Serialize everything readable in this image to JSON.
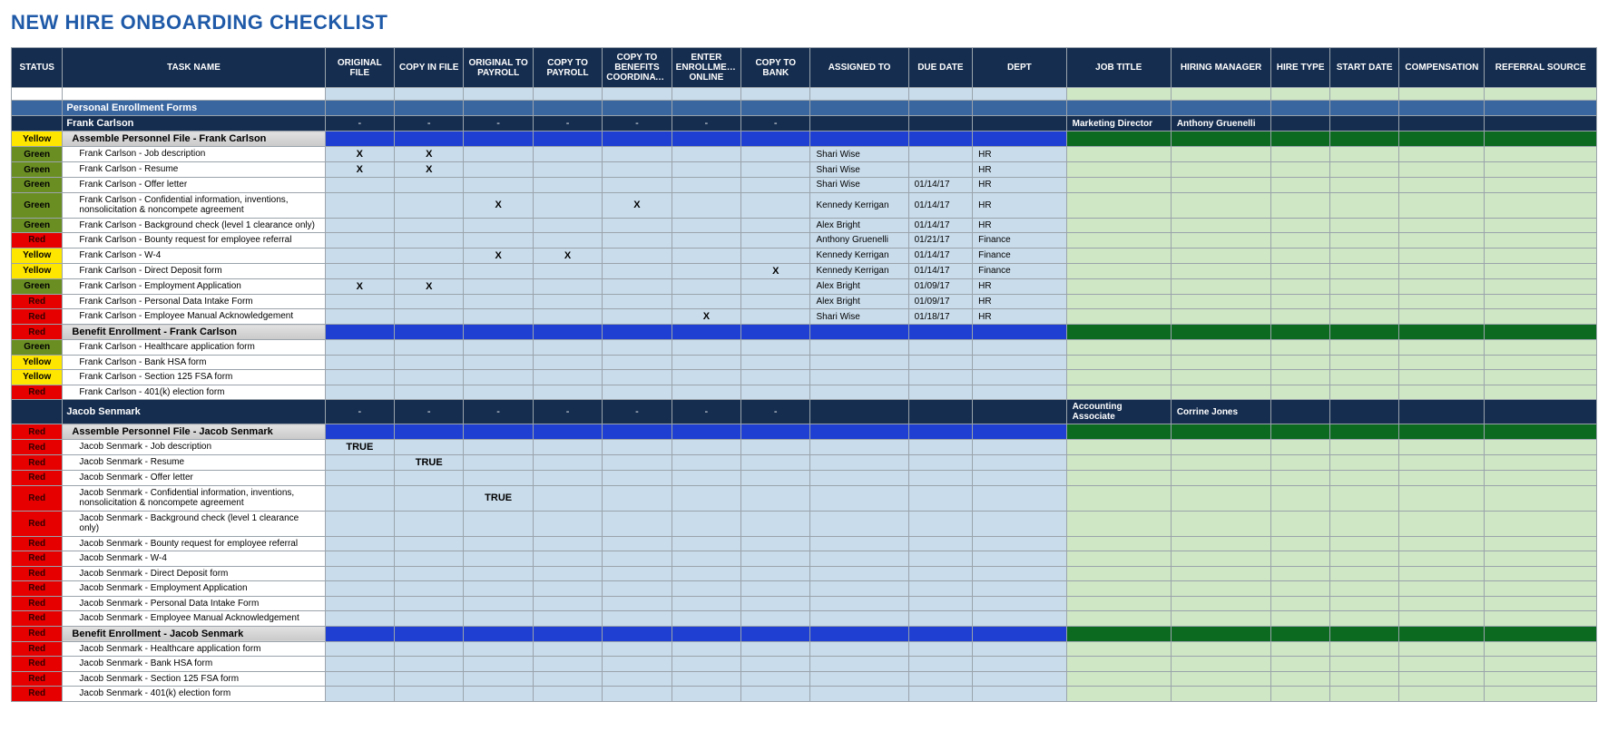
{
  "title": "NEW HIRE ONBOARDING CHECKLIST",
  "headers": {
    "status": "STATUS",
    "task": "TASK NAME",
    "orig": "ORIGINAL FILE",
    "copy": "COPY IN FILE",
    "payroll": "ORIGINAL TO PAYROLL",
    "copypay": "COPY TO PAYROLL",
    "benefits": "COPY TO BENEFITS COORDINATOR",
    "enroll": "ENTER ENROLLMENT ONLINE",
    "bank": "COPY TO BANK",
    "assigned": "ASSIGNED TO",
    "due": "DUE DATE",
    "dept": "DEPT",
    "job": "JOB TITLE",
    "hm": "HIRING MANAGER",
    "htype": "HIRE TYPE",
    "sdate": "START DATE",
    "comp": "COMPENSATION",
    "ref": "REFERRAL SOURCE"
  },
  "section_major": "Personal Enrollment Forms",
  "fc": {
    "name": "Frank Carlson",
    "job": "Marketing Director",
    "hm": "Anthony Gruenelli",
    "group1": "Assemble Personnel File - Frank Carlson",
    "group1_status": "Yellow",
    "tasks1": [
      {
        "s": "Green",
        "n": "Frank Carlson - Job description",
        "x": [
          "X",
          "X",
          "",
          "",
          "",
          "",
          ""
        ],
        "a": "Shari Wise",
        "d": "",
        "p": "HR"
      },
      {
        "s": "Green",
        "n": "Frank Carlson - Resume",
        "x": [
          "X",
          "X",
          "",
          "",
          "",
          "",
          ""
        ],
        "a": "Shari Wise",
        "d": "",
        "p": "HR"
      },
      {
        "s": "Green",
        "n": "Frank Carlson - Offer letter",
        "x": [
          "",
          "",
          "",
          "",
          "",
          "",
          ""
        ],
        "a": "Shari Wise",
        "d": "01/14/17",
        "p": "HR"
      },
      {
        "s": "Green",
        "n": "Frank Carlson - Confidential information, inventions, nonsolicitation & noncompete agreement",
        "x": [
          "",
          "",
          "X",
          "",
          "X",
          "",
          ""
        ],
        "a": "Kennedy Kerrigan",
        "d": "01/14/17",
        "p": "HR"
      },
      {
        "s": "Green",
        "n": "Frank Carlson - Background check (level 1 clearance only)",
        "x": [
          "",
          "",
          "",
          "",
          "",
          "",
          ""
        ],
        "a": "Alex Bright",
        "d": "01/14/17",
        "p": "HR"
      },
      {
        "s": "Red",
        "n": "Frank Carlson - Bounty request for employee referral",
        "x": [
          "",
          "",
          "",
          "",
          "",
          "",
          ""
        ],
        "a": "Anthony Gruenelli",
        "d": "01/21/17",
        "p": "Finance"
      },
      {
        "s": "Yellow",
        "n": "Frank Carlson - W-4",
        "x": [
          "",
          "",
          "X",
          "X",
          "",
          "",
          ""
        ],
        "a": "Kennedy Kerrigan",
        "d": "01/14/17",
        "p": "Finance"
      },
      {
        "s": "Yellow",
        "n": "Frank Carlson - Direct Deposit form",
        "x": [
          "",
          "",
          "",
          "",
          "",
          "",
          "X"
        ],
        "a": "Kennedy Kerrigan",
        "d": "01/14/17",
        "p": "Finance"
      },
      {
        "s": "Green",
        "n": "Frank Carlson - Employment Application",
        "x": [
          "X",
          "X",
          "",
          "",
          "",
          "",
          ""
        ],
        "a": "Alex Bright",
        "d": "01/09/17",
        "p": "HR"
      },
      {
        "s": "Red",
        "n": "Frank Carlson - Personal Data Intake Form",
        "x": [
          "",
          "",
          "",
          "",
          "",
          "",
          ""
        ],
        "a": "Alex Bright",
        "d": "01/09/17",
        "p": "HR"
      },
      {
        "s": "Red",
        "n": "Frank Carlson - Employee Manual Acknowledgement",
        "x": [
          "",
          "",
          "",
          "",
          "",
          "X",
          ""
        ],
        "a": "Shari Wise",
        "d": "01/18/17",
        "p": "HR"
      }
    ],
    "group2": "Benefit Enrollment - Frank Carlson",
    "group2_status": "Red",
    "tasks2": [
      {
        "s": "Green",
        "n": "Frank Carlson - Healthcare application form",
        "x": [
          "",
          "",
          "",
          "",
          "",
          "",
          ""
        ],
        "a": "",
        "d": "",
        "p": ""
      },
      {
        "s": "Yellow",
        "n": "Frank Carlson - Bank HSA form",
        "x": [
          "",
          "",
          "",
          "",
          "",
          "",
          ""
        ],
        "a": "",
        "d": "",
        "p": ""
      },
      {
        "s": "Yellow",
        "n": "Frank Carlson - Section 125 FSA form",
        "x": [
          "",
          "",
          "",
          "",
          "",
          "",
          ""
        ],
        "a": "",
        "d": "",
        "p": ""
      },
      {
        "s": "Red",
        "n": "Frank Carlson - 401(k) election form",
        "x": [
          "",
          "",
          "",
          "",
          "",
          "",
          ""
        ],
        "a": "",
        "d": "",
        "p": ""
      }
    ]
  },
  "js": {
    "name": "Jacob Senmark",
    "job": "Accounting Associate",
    "hm": "Corrine Jones",
    "group1": "Assemble Personnel File - Jacob Senmark",
    "group1_status": "Red",
    "tasks1": [
      {
        "s": "Red",
        "n": "Jacob Senmark - Job description",
        "x": [
          "TRUE",
          "",
          "",
          "",
          "",
          "",
          ""
        ],
        "a": "",
        "d": "",
        "p": ""
      },
      {
        "s": "Red",
        "n": "Jacob Senmark - Resume",
        "x": [
          "",
          "TRUE",
          "",
          "",
          "",
          "",
          ""
        ],
        "a": "",
        "d": "",
        "p": ""
      },
      {
        "s": "Red",
        "n": "Jacob Senmark - Offer letter",
        "x": [
          "",
          "",
          "",
          "",
          "",
          "",
          ""
        ],
        "a": "",
        "d": "",
        "p": ""
      },
      {
        "s": "Red",
        "n": "Jacob Senmark - Confidential information, inventions, nonsolicitation & noncompete agreement",
        "x": [
          "",
          "",
          "TRUE",
          "",
          "",
          "",
          ""
        ],
        "a": "",
        "d": "",
        "p": ""
      },
      {
        "s": "Red",
        "n": "Jacob Senmark - Background check (level 1 clearance only)",
        "x": [
          "",
          "",
          "",
          "",
          "",
          "",
          ""
        ],
        "a": "",
        "d": "",
        "p": ""
      },
      {
        "s": "Red",
        "n": "Jacob Senmark - Bounty request for employee referral",
        "x": [
          "",
          "",
          "",
          "",
          "",
          "",
          ""
        ],
        "a": "",
        "d": "",
        "p": ""
      },
      {
        "s": "Red",
        "n": "Jacob Senmark - W-4",
        "x": [
          "",
          "",
          "",
          "",
          "",
          "",
          ""
        ],
        "a": "",
        "d": "",
        "p": ""
      },
      {
        "s": "Red",
        "n": "Jacob Senmark - Direct Deposit form",
        "x": [
          "",
          "",
          "",
          "",
          "",
          "",
          ""
        ],
        "a": "",
        "d": "",
        "p": ""
      },
      {
        "s": "Red",
        "n": "Jacob Senmark - Employment Application",
        "x": [
          "",
          "",
          "",
          "",
          "",
          "",
          ""
        ],
        "a": "",
        "d": "",
        "p": ""
      },
      {
        "s": "Red",
        "n": "Jacob Senmark - Personal Data Intake Form",
        "x": [
          "",
          "",
          "",
          "",
          "",
          "",
          ""
        ],
        "a": "",
        "d": "",
        "p": ""
      },
      {
        "s": "Red",
        "n": "Jacob Senmark - Employee Manual Acknowledgement",
        "x": [
          "",
          "",
          "",
          "",
          "",
          "",
          ""
        ],
        "a": "",
        "d": "",
        "p": ""
      }
    ],
    "group2": "Benefit Enrollment - Jacob Senmark",
    "group2_status": "Red",
    "tasks2": [
      {
        "s": "Red",
        "n": "Jacob Senmark - Healthcare application form",
        "x": [
          "",
          "",
          "",
          "",
          "",
          "",
          ""
        ],
        "a": "",
        "d": "",
        "p": ""
      },
      {
        "s": "Red",
        "n": "Jacob Senmark - Bank HSA form",
        "x": [
          "",
          "",
          "",
          "",
          "",
          "",
          ""
        ],
        "a": "",
        "d": "",
        "p": ""
      },
      {
        "s": "Red",
        "n": "Jacob Senmark - Section 125 FSA form",
        "x": [
          "",
          "",
          "",
          "",
          "",
          "",
          ""
        ],
        "a": "",
        "d": "",
        "p": ""
      },
      {
        "s": "Red",
        "n": "Jacob Senmark - 401(k) election form",
        "x": [
          "",
          "",
          "",
          "",
          "",
          "",
          ""
        ],
        "a": "",
        "d": "",
        "p": ""
      }
    ]
  }
}
